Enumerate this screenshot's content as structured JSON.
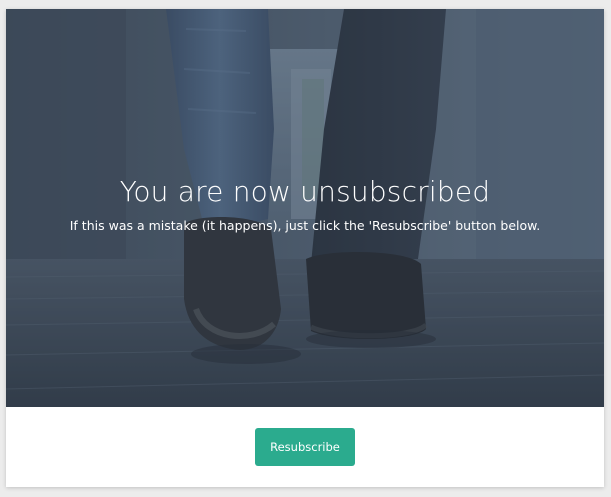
{
  "hero": {
    "title": "You are now unsubscribed",
    "subtitle": "If this was a mistake (it happens), just click the 'Resubscribe' button below."
  },
  "footer": {
    "resubscribe_label": "Resubscribe"
  },
  "colors": {
    "accent": "#2bab8e",
    "hero_tint": "#4a5a6c",
    "text_on_hero": "#ffffff"
  },
  "icons": {
    "hero_image": "walking-shoes-photo"
  }
}
